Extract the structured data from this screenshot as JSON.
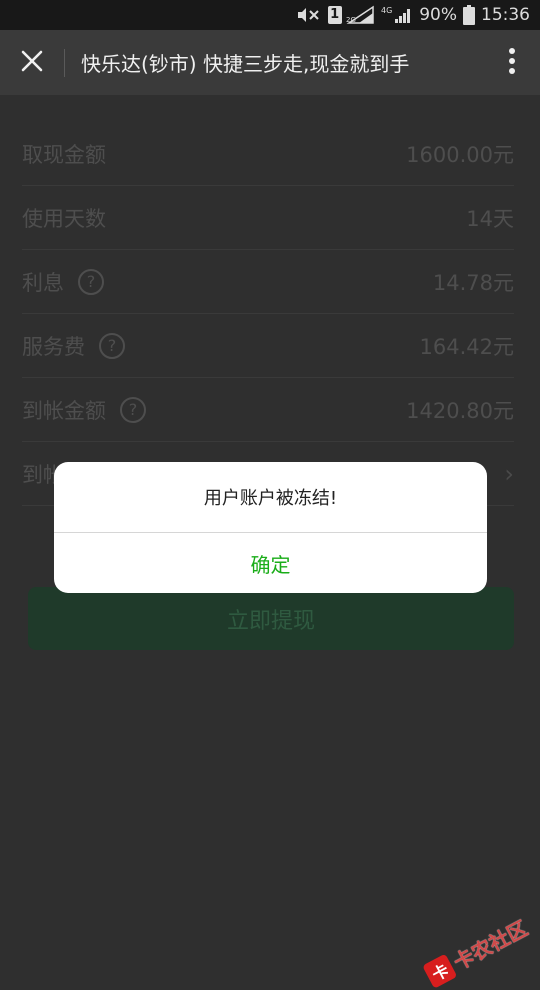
{
  "status_bar": {
    "sim": "1",
    "battery": "90%",
    "time": "15:36"
  },
  "title_bar": {
    "title": "快乐达(钞市) 快捷三步走,现金就到手"
  },
  "rows": [
    {
      "label": "取现金额",
      "value": "1600.00元",
      "help": false
    },
    {
      "label": "使用天数",
      "value": "14天",
      "help": false
    },
    {
      "label": "利息",
      "value": "14.78元",
      "help": true
    },
    {
      "label": "服务费",
      "value": "164.42元",
      "help": true
    },
    {
      "label": "到帐金额",
      "value": "1420.80元",
      "help": true
    },
    {
      "label": "到帐",
      "value": "",
      "help": false,
      "chevron": true
    }
  ],
  "submit_button": "立即提现",
  "modal": {
    "message": "用户账户被冻结!",
    "confirm": "确定"
  },
  "watermark": {
    "logo": "卡",
    "text": "卡农社区"
  },
  "colors": {
    "confirm_green": "#1aad19",
    "title_bar_bg": "#3a3a3a",
    "status_bar_bg": "#181818"
  },
  "icons": {
    "close": "close-icon",
    "more": "more-vertical-icon",
    "help": "question-circle-icon"
  }
}
